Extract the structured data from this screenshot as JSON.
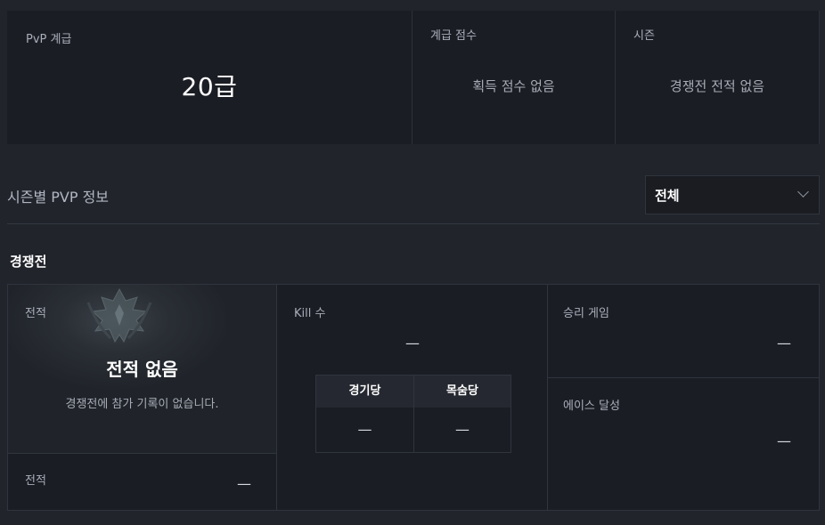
{
  "summary": {
    "grade_label": "PvP 계급",
    "grade_value": "20급",
    "score_label": "계급 점수",
    "score_msg": "획득 점수 없음",
    "season_label": "시즌",
    "season_msg": "경쟁전 전적 없음"
  },
  "season_section": {
    "title": "시즌별 PVP 정보",
    "select_value": "전체"
  },
  "competitive": {
    "title": "경쟁전",
    "record_label": "전적",
    "no_record_title": "전적 없음",
    "no_record_desc": "경쟁전에 참가 기록이 없습니다.",
    "record_bottom_label": "전적",
    "record_bottom_value": "—",
    "kill_label": "Kill 수",
    "kill_value": "—",
    "per_game_header": "경기당",
    "per_life_header": "목숨당",
    "per_game_value": "—",
    "per_life_value": "—",
    "win_label": "승리 게임",
    "win_value": "—",
    "ace_label": "에이스 달성",
    "ace_value": "—"
  },
  "colors": {
    "background": "#21242b",
    "card": "#1b1d24",
    "border": "#30343c"
  }
}
